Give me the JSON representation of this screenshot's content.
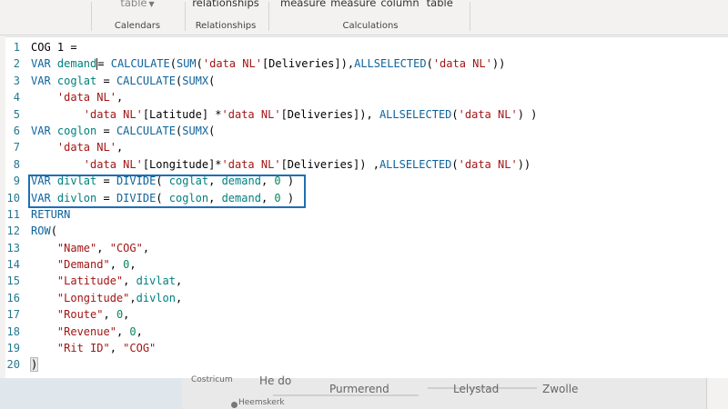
{
  "ribbon": {
    "groups": [
      {
        "items": [
          "table"
        ],
        "name": "Calendars"
      },
      {
        "items": [
          "relationships"
        ],
        "name": "Relationships"
      },
      {
        "items": [
          "measure",
          "measure",
          "column",
          "table"
        ],
        "name": "Calculations"
      }
    ],
    "left_group_partial": "e"
  },
  "editor": {
    "lines": [
      {
        "n": "1",
        "t": [
          [
            "pn",
            "COG 1 ="
          ]
        ]
      },
      {
        "n": "2",
        "t": [
          [
            "kw",
            "VAR "
          ],
          [
            "var",
            "demand"
          ],
          [
            "cursor",
            ""
          ],
          [
            "pn",
            "= "
          ],
          [
            "fn",
            "CALCULATE"
          ],
          [
            "pn",
            "("
          ],
          [
            "fn",
            "SUM"
          ],
          [
            "pn",
            "("
          ],
          [
            "str",
            "'data NL'"
          ],
          [
            "pn",
            "[Deliveries]),"
          ],
          [
            "fn",
            "ALLSELECTED"
          ],
          [
            "pn",
            "("
          ],
          [
            "str",
            "'data NL'"
          ],
          [
            "pn",
            "))"
          ]
        ]
      },
      {
        "n": "3",
        "t": [
          [
            "kw",
            "VAR "
          ],
          [
            "var",
            "coglat"
          ],
          [
            "pn",
            " = "
          ],
          [
            "fn",
            "CALCULATE"
          ],
          [
            "pn",
            "("
          ],
          [
            "fn",
            "SUMX"
          ],
          [
            "pn",
            "("
          ]
        ]
      },
      {
        "n": "4",
        "t": [
          [
            "pn",
            "    "
          ],
          [
            "str",
            "'data NL'"
          ],
          [
            "pn",
            ","
          ]
        ]
      },
      {
        "n": "5",
        "t": [
          [
            "pn",
            "        "
          ],
          [
            "str",
            "'data NL'"
          ],
          [
            "pn",
            "[Latitude] *"
          ],
          [
            "str",
            "'data NL'"
          ],
          [
            "pn",
            "[Deliveries]), "
          ],
          [
            "fn",
            "ALLSELECTED"
          ],
          [
            "pn",
            "("
          ],
          [
            "str",
            "'data NL'"
          ],
          [
            "pn",
            ") )"
          ]
        ]
      },
      {
        "n": "6",
        "t": [
          [
            "kw",
            "VAR "
          ],
          [
            "var",
            "coglon"
          ],
          [
            "pn",
            " = "
          ],
          [
            "fn",
            "CALCULATE"
          ],
          [
            "pn",
            "("
          ],
          [
            "fn",
            "SUMX"
          ],
          [
            "pn",
            "("
          ]
        ]
      },
      {
        "n": "7",
        "t": [
          [
            "pn",
            "    "
          ],
          [
            "str",
            "'data NL'"
          ],
          [
            "pn",
            ","
          ]
        ]
      },
      {
        "n": "8",
        "t": [
          [
            "pn",
            "        "
          ],
          [
            "str",
            "'data NL'"
          ],
          [
            "pn",
            "[Longitude]*"
          ],
          [
            "str",
            "'data NL'"
          ],
          [
            "pn",
            "[Deliveries]) ,"
          ],
          [
            "fn",
            "ALLSELECTED"
          ],
          [
            "pn",
            "("
          ],
          [
            "str",
            "'data NL'"
          ],
          [
            "pn",
            "))"
          ]
        ]
      },
      {
        "n": "9",
        "t": [
          [
            "kw",
            "VAR "
          ],
          [
            "var",
            "divlat"
          ],
          [
            "pn",
            " = "
          ],
          [
            "fn",
            "DIVIDE"
          ],
          [
            "pn",
            "( "
          ],
          [
            "var",
            "coglat"
          ],
          [
            "pn",
            ", "
          ],
          [
            "var",
            "demand"
          ],
          [
            "pn",
            ", "
          ],
          [
            "num",
            "0"
          ],
          [
            "pn",
            " )"
          ]
        ]
      },
      {
        "n": "10",
        "t": [
          [
            "kw",
            "VAR "
          ],
          [
            "var",
            "divlon"
          ],
          [
            "pn",
            " = "
          ],
          [
            "fn",
            "DIVIDE"
          ],
          [
            "pn",
            "( "
          ],
          [
            "var",
            "coglon"
          ],
          [
            "pn",
            ", "
          ],
          [
            "var",
            "demand"
          ],
          [
            "pn",
            ", "
          ],
          [
            "num",
            "0"
          ],
          [
            "pn",
            " )"
          ]
        ]
      },
      {
        "n": "11",
        "t": [
          [
            "kw",
            "RETURN"
          ]
        ]
      },
      {
        "n": "12",
        "t": [
          [
            "fn",
            "ROW"
          ],
          [
            "pn",
            "("
          ]
        ]
      },
      {
        "n": "13",
        "t": [
          [
            "pn",
            "    "
          ],
          [
            "str",
            "\"Name\""
          ],
          [
            "pn",
            ", "
          ],
          [
            "str",
            "\"COG\""
          ],
          [
            "pn",
            ","
          ]
        ]
      },
      {
        "n": "14",
        "t": [
          [
            "pn",
            "    "
          ],
          [
            "str",
            "\"Demand\""
          ],
          [
            "pn",
            ", "
          ],
          [
            "num",
            "0"
          ],
          [
            "pn",
            ","
          ]
        ]
      },
      {
        "n": "15",
        "t": [
          [
            "pn",
            "    "
          ],
          [
            "str",
            "\"Latitude\""
          ],
          [
            "pn",
            ", "
          ],
          [
            "var",
            "divlat"
          ],
          [
            "pn",
            ","
          ]
        ]
      },
      {
        "n": "16",
        "t": [
          [
            "pn",
            "    "
          ],
          [
            "str",
            "\"Longitude\""
          ],
          [
            "pn",
            ","
          ],
          [
            "var",
            "divlon"
          ],
          [
            "pn",
            ","
          ]
        ]
      },
      {
        "n": "17",
        "t": [
          [
            "pn",
            "    "
          ],
          [
            "str",
            "\"Route\""
          ],
          [
            "pn",
            ", "
          ],
          [
            "num",
            "0"
          ],
          [
            "pn",
            ","
          ]
        ]
      },
      {
        "n": "18",
        "t": [
          [
            "pn",
            "    "
          ],
          [
            "str",
            "\"Revenue\""
          ],
          [
            "pn",
            ", "
          ],
          [
            "num",
            "0"
          ],
          [
            "pn",
            ","
          ]
        ]
      },
      {
        "n": "19",
        "t": [
          [
            "pn",
            "    "
          ],
          [
            "str",
            "\"Rit ID\""
          ],
          [
            "pn",
            ", "
          ],
          [
            "str",
            "\"COG\""
          ]
        ]
      },
      {
        "n": "20",
        "t": [
          [
            "bracket",
            ")"
          ]
        ]
      }
    ]
  },
  "map": {
    "labels": [
      "He  do",
      "Purmerend",
      "Lelystad",
      "Zwolle",
      "Costricum",
      "Heemskerk"
    ]
  },
  "colors": {
    "keyword": "#0e639c",
    "variable": "#008080",
    "string": "#a31515",
    "number": "#098658",
    "highlight_box": "#1e6fb3",
    "line_number": "#237893"
  }
}
